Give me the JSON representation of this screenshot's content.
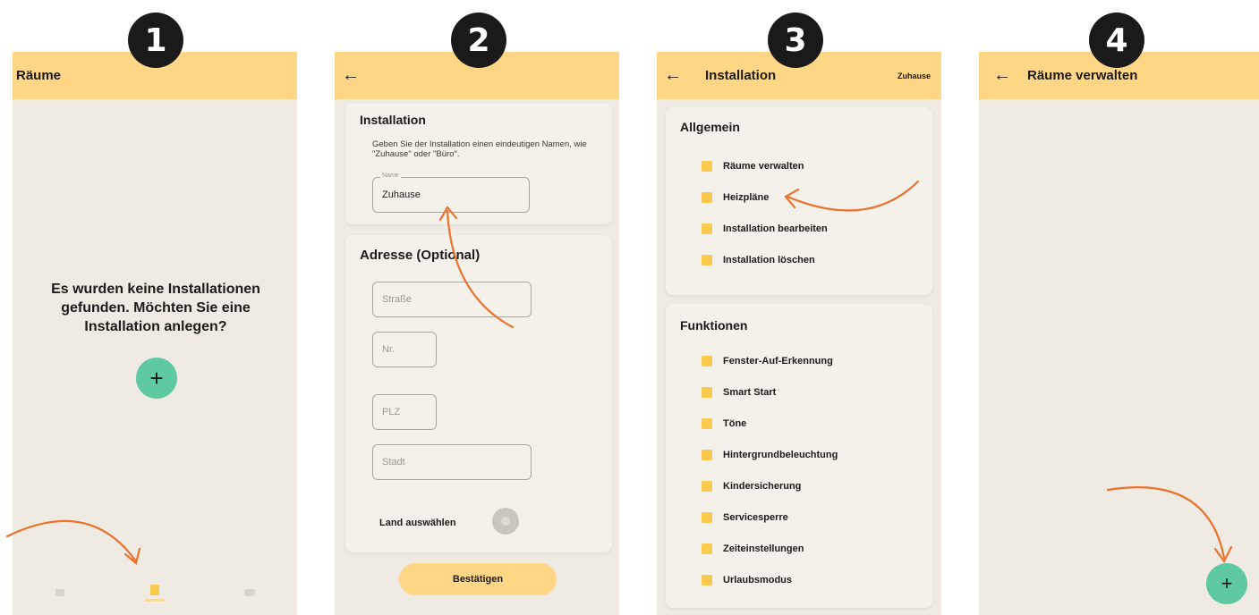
{
  "colors": {
    "appbar": "#fed686",
    "screen_bg": "#efebe3",
    "fab": "#5fc9a1",
    "arrow": "#e8732e",
    "step_badge": "#1a1a1a",
    "icon_yellow": "#f9c94d"
  },
  "steps": [
    "1",
    "2",
    "3",
    "4"
  ],
  "screen1": {
    "title": "Räume",
    "empty_message": "Es wurden keine Installationen gefunden. Möchten Sie eine Installation anlegen?",
    "add_icon": "+",
    "bottom_nav": [
      {
        "icon": "home-icon"
      },
      {
        "icon": "rooms-icon"
      },
      {
        "icon": "settings-icon"
      }
    ]
  },
  "screen2": {
    "back_icon": "←",
    "section_title": "Installation",
    "description": "Geben Sie der Installation einen eindeutigen Namen, wie \"Zuhause\" oder \"Büro\".",
    "name_label": "Name",
    "name_value": "Zuhause",
    "address_title": "Adresse (Optional)",
    "street_placeholder": "Straße",
    "number_placeholder": "Nr.",
    "zip_placeholder": "PLZ",
    "city_placeholder": "Stadt",
    "country_label": "Land auswählen",
    "confirm_label": "Bestätigen"
  },
  "screen3": {
    "back_icon": "←",
    "title": "Installation",
    "subtitle": "Zuhause",
    "general_title": "Allgemein",
    "general_items": [
      "Räume verwalten",
      "Heizpläne",
      "Installation bearbeiten",
      "Installation löschen"
    ],
    "functions_title": "Funktionen",
    "function_items": [
      "Fenster-Auf-Erkennung",
      "Smart Start",
      "Töne",
      "Hintergrundbeleuchtung",
      "Kindersicherung",
      "Servicesperre",
      "Zeiteinstellungen",
      "Urlaubsmodus"
    ]
  },
  "screen4": {
    "back_icon": "←",
    "title": "Räume verwalten",
    "add_icon": "+"
  }
}
